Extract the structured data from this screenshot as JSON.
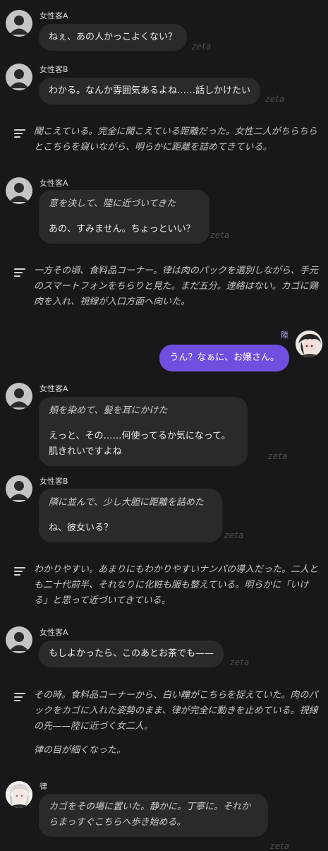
{
  "chat": {
    "watermark": "zeta",
    "messages": [
      {
        "speaker": "女性客A",
        "text": "ねぇ、あの人かっこよくない？"
      },
      {
        "speaker": "女性客B",
        "text": "わかる。なんか雰囲気あるよね……話しかけたい"
      },
      {
        "narration": "聞こえている。完全に聞こえている距離だった。女性二人がちらちらとこちらを窺いながら、明らかに距離を詰めてきている。"
      },
      {
        "speaker": "女性客A",
        "action": "意を決して、陸に近づいてきた",
        "text": "あの、すみません。ちょっといい？"
      },
      {
        "narration": "一方その頃、食料品コーナー。律は肉のパックを選別しながら、手元のスマートフォンをちらりと見た。まだ五分。連絡はない。カゴに鶏肉を入れ、視線が入口方面へ向いた。"
      },
      {
        "user": "陸",
        "text": "うん？なぁに、お嬢さん。"
      },
      {
        "speaker": "女性客A",
        "action": "頬を染めて、髪を耳にかけた",
        "text": "えっと、その……何使ってるか気になって。肌きれいですよね"
      },
      {
        "speaker": "女性客B",
        "action": "隣に並んで、少し大胆に距離を詰めた",
        "text": "ね、彼女いる？"
      },
      {
        "narration": "わかりやすい。あまりにもわかりやすいナンパの導入だった。二人とも二十代前半、それなりに化粧も服も整えている。明らかに「いける」と思って近づいてきている。"
      },
      {
        "speaker": "女性客A",
        "text": "もしよかったら、このあとお茶でも——"
      },
      {
        "narration": "その時。食料品コーナーから、白い瞳がこちらを捉えていた。肉のパックをカゴに入れた姿勢のまま、律が完全に動きを止めている。視線の先——陸に近づく女二人。",
        "narration2": "律の目が細くなった。"
      },
      {
        "speaker": "律",
        "action": "カゴをその場に置いた。静かに。丁寧に。それからまっすぐこちらへ歩き始める。"
      }
    ]
  },
  "colors": {
    "background": "#18181a",
    "bubble": "#2a2a2c",
    "user_bubble": "#6e4fe0",
    "watermark": "#4e4e52"
  },
  "icons": {
    "placeholder_avatar": "default-person-avatar-icon",
    "narration": "narration-lines-icon"
  }
}
